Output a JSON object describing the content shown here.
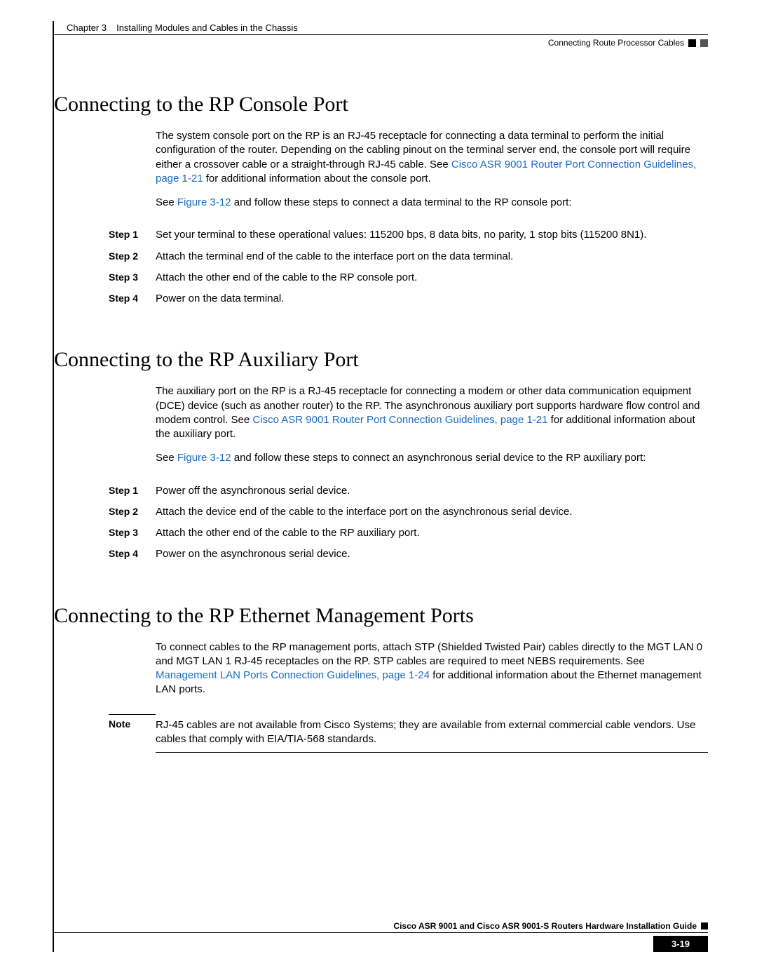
{
  "header": {
    "chapter_label": "Chapter 3",
    "chapter_title": "Installing Modules and Cables in the Chassis",
    "section_sub": "Connecting Route Processor Cables"
  },
  "sections": {
    "console": {
      "title": "Connecting to the RP Console Port",
      "intro_1a": "The system console port on the RP is an RJ-45 receptacle for connecting a data terminal to perform the initial configuration of the router. Depending on the cabling pinout on the terminal server end, the console port will require either a crossover cable or a straight-through RJ-45 cable. See ",
      "intro_1_link1": "Cisco ASR 9001 Router Port Connection Guidelines, page 1-21",
      "intro_1b": " for additional information about the console port.",
      "intro_2a": "See ",
      "intro_2_link": "Figure 3-12",
      "intro_2b": " and follow these steps to connect a data terminal to the RP console port:",
      "steps": [
        {
          "label": "Step 1",
          "text": "Set your terminal to these operational values: 115200 bps, 8 data bits, no parity, 1 stop bits (115200 8N1)."
        },
        {
          "label": "Step 2",
          "text": "Attach the terminal end of the cable to the interface port on the data terminal."
        },
        {
          "label": "Step 3",
          "text": "Attach the other end of the cable to the RP console port."
        },
        {
          "label": "Step 4",
          "text": "Power on the data terminal."
        }
      ]
    },
    "aux": {
      "title": "Connecting to the RP Auxiliary Port",
      "intro_1a": "The auxiliary port on the RP is a RJ-45 receptacle for connecting a modem or other data communication equipment (DCE) device (such as another router) to the RP. The asynchronous auxiliary port supports hardware flow control and modem control. See ",
      "intro_1_link1": "Cisco ASR 9001 Router Port Connection Guidelines, page 1-21",
      "intro_1b": " for additional information about the auxiliary port.",
      "intro_2a": "See ",
      "intro_2_link": "Figure 3-12",
      "intro_2b": " and follow these steps to connect an asynchronous serial device to the RP auxiliary port:",
      "steps": [
        {
          "label": "Step 1",
          "text": "Power off the asynchronous serial device."
        },
        {
          "label": "Step 2",
          "text": "Attach the device end of the cable to the interface port on the asynchronous serial device."
        },
        {
          "label": "Step 3",
          "text": "Attach the other end of the cable to the RP auxiliary port."
        },
        {
          "label": "Step 4",
          "text": "Power on the asynchronous serial device."
        }
      ]
    },
    "eth": {
      "title": "Connecting to the RP Ethernet Management Ports",
      "intro_1a": "To connect cables to the RP management ports, attach STP (Shielded Twisted Pair) cables directly to the MGT LAN 0 and MGT LAN 1 RJ-45 receptacles on the RP. STP cables are required to meet NEBS requirements. See ",
      "intro_1_link1": "Management LAN Ports Connection Guidelines, page 1-24",
      "intro_1b": " for additional information about the Ethernet management LAN ports.",
      "note_label": "Note",
      "note_text": "RJ-45 cables are not available from Cisco Systems; they are available from external commercial cable vendors. Use cables that comply with EIA/TIA-568 standards."
    }
  },
  "footer": {
    "guide_title": "Cisco ASR 9001 and Cisco ASR 9001-S Routers Hardware Installation Guide",
    "page_number": "3-19"
  }
}
